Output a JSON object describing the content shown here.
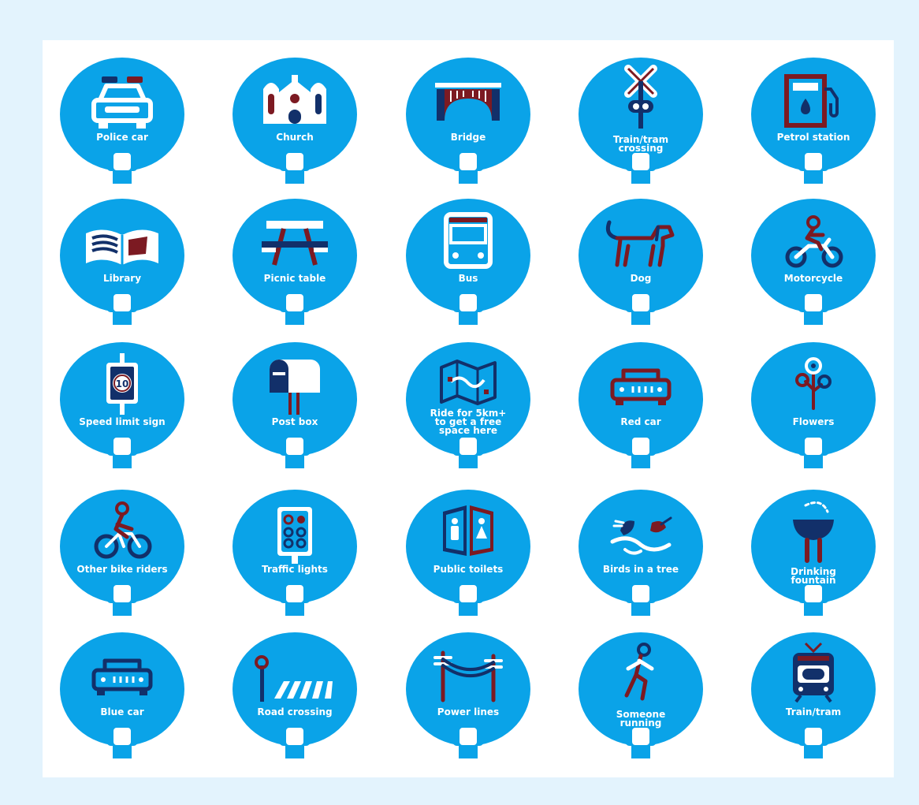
{
  "colors": {
    "disc": "#0aa3e8",
    "navy": "#12306a",
    "maroon": "#7c1a22",
    "white": "#ffffff",
    "page": "#e3f3fd"
  },
  "tiles": [
    {
      "label": "Police car",
      "icon": "police-car-icon"
    },
    {
      "label": "Church",
      "icon": "church-icon"
    },
    {
      "label": "Bridge",
      "icon": "bridge-icon"
    },
    {
      "label": "Train/tram crossing",
      "icon": "railway-crossing-icon"
    },
    {
      "label": "Petrol station",
      "icon": "fuel-pump-icon"
    },
    {
      "label": "Library",
      "icon": "open-book-icon"
    },
    {
      "label": "Picnic table",
      "icon": "picnic-table-icon"
    },
    {
      "label": "Bus",
      "icon": "bus-icon"
    },
    {
      "label": "Dog",
      "icon": "dog-icon"
    },
    {
      "label": "Motorcycle",
      "icon": "motorcycle-icon"
    },
    {
      "label": "Speed limit sign",
      "icon": "speed-sign-icon"
    },
    {
      "label": "Post box",
      "icon": "mailbox-icon"
    },
    {
      "label": "Ride for 5km+ to get a free space here",
      "icon": "map-icon"
    },
    {
      "label": "Red car",
      "icon": "red-car-icon"
    },
    {
      "label": "Flowers",
      "icon": "flowers-icon"
    },
    {
      "label": "Other bike riders",
      "icon": "cyclist-icon"
    },
    {
      "label": "Traffic lights",
      "icon": "traffic-lights-icon"
    },
    {
      "label": "Public toilets",
      "icon": "toilets-icon"
    },
    {
      "label": "Birds in a tree",
      "icon": "birds-icon"
    },
    {
      "label": "Drinking fountain",
      "icon": "drinking-fountain-icon"
    },
    {
      "label": "Blue car",
      "icon": "blue-car-icon"
    },
    {
      "label": "Road crossing",
      "icon": "pedestrian-crossing-icon"
    },
    {
      "label": "Power lines",
      "icon": "power-lines-icon"
    },
    {
      "label": "Someone running",
      "icon": "runner-icon"
    },
    {
      "label": "Train/tram",
      "icon": "train-icon"
    }
  ]
}
